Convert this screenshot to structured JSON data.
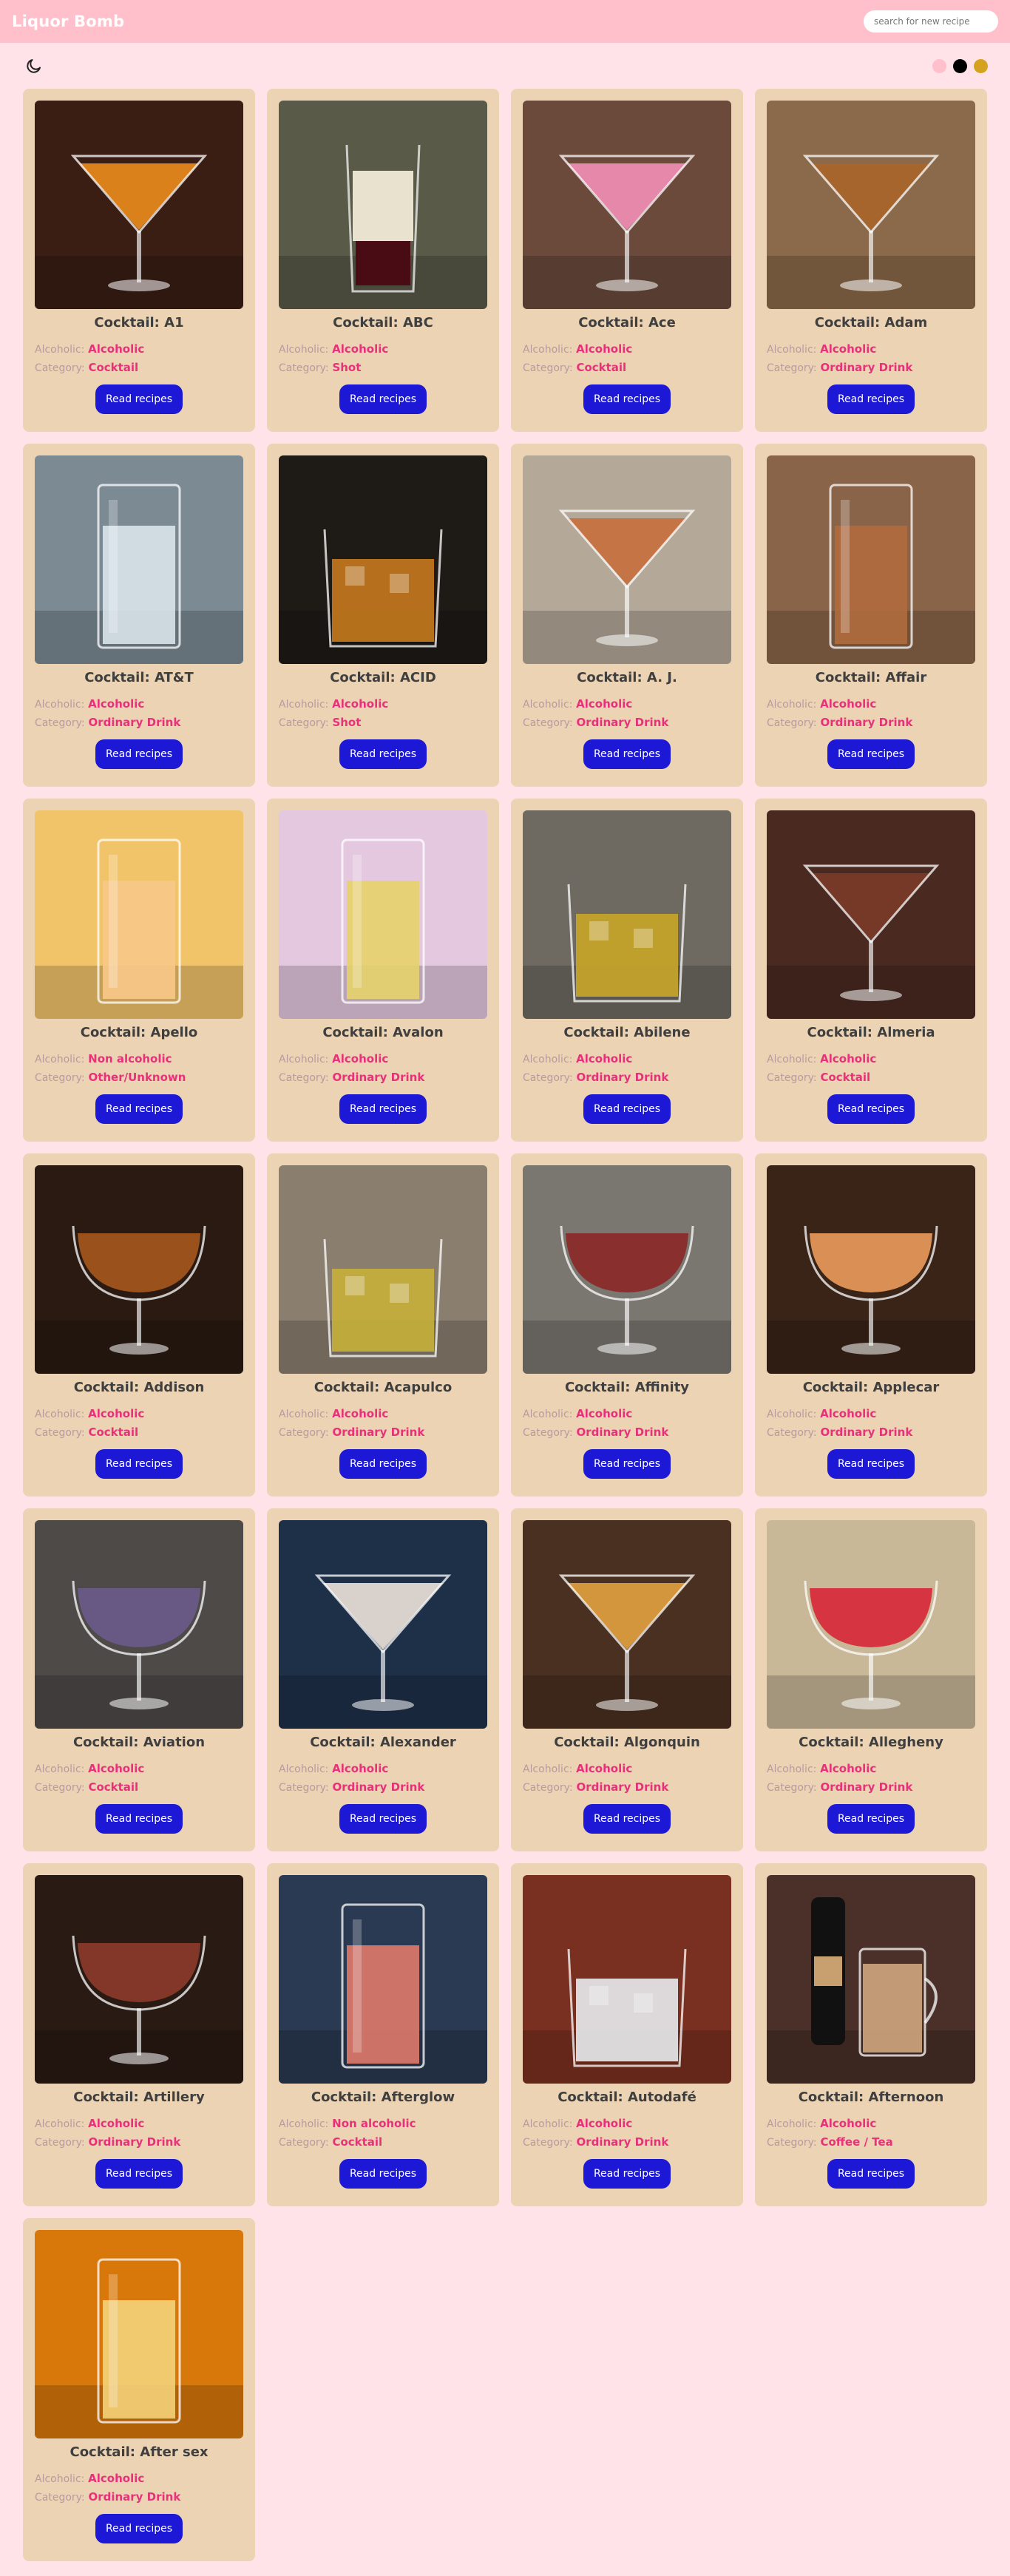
{
  "header": {
    "brand": "Liquor Bomb",
    "search_placeholder": "search for new recipe"
  },
  "toolbar": {
    "theme_icon": "moon-icon",
    "swatches": [
      "#ffbfcb",
      "#000000",
      "#d4a21c"
    ]
  },
  "labels": {
    "alcoholic": "Alcoholic:",
    "category": "Category:",
    "button": "Read recipes"
  },
  "cocktails": [
    {
      "name": "Cocktail: A1",
      "alcoholic": "Alcoholic",
      "category": "Cocktail",
      "bg": "#3a1e14",
      "liquid": "#e88a1c",
      "glass": "martini"
    },
    {
      "name": "Cocktail: ABC",
      "alcoholic": "Alcoholic",
      "category": "Shot",
      "bg": "#5a5a48",
      "liquid": "#e8e2cf",
      "glass": "shot"
    },
    {
      "name": "Cocktail: Ace",
      "alcoholic": "Alcoholic",
      "category": "Cocktail",
      "bg": "#6b4a3c",
      "liquid": "#f08db4",
      "glass": "martini"
    },
    {
      "name": "Cocktail: Adam",
      "alcoholic": "Alcoholic",
      "category": "Ordinary Drink",
      "bg": "#8a6a4a",
      "liquid": "#a8652a",
      "glass": "martini"
    },
    {
      "name": "Cocktail: AT&T",
      "alcoholic": "Alcoholic",
      "category": "Ordinary Drink",
      "bg": "#7c8a94",
      "liquid": "#d9e4ea",
      "glass": "highball"
    },
    {
      "name": "Cocktail: ACID",
      "alcoholic": "Alcoholic",
      "category": "Shot",
      "bg": "#1e1a16",
      "liquid": "#c77a1e",
      "glass": "rocks"
    },
    {
      "name": "Cocktail: A. J.",
      "alcoholic": "Alcoholic",
      "category": "Ordinary Drink",
      "bg": "#b4a898",
      "liquid": "#c7703e",
      "glass": "martini"
    },
    {
      "name": "Cocktail: Affair",
      "alcoholic": "Alcoholic",
      "category": "Ordinary Drink",
      "bg": "#8a6448",
      "liquid": "#b06a3e",
      "glass": "highball"
    },
    {
      "name": "Cocktail: Apello",
      "alcoholic": "Non alcoholic",
      "category": "Other/Unknown",
      "bg": "#f2c46a",
      "liquid": "#f7c88a",
      "glass": "highball"
    },
    {
      "name": "Cocktail: Avalon",
      "alcoholic": "Alcoholic",
      "category": "Ordinary Drink",
      "bg": "#e4c8e0",
      "liquid": "#e6d16a",
      "glass": "highball"
    },
    {
      "name": "Cocktail: Abilene",
      "alcoholic": "Alcoholic",
      "category": "Ordinary Drink",
      "bg": "#6e6a62",
      "liquid": "#c9a628",
      "glass": "rocks"
    },
    {
      "name": "Cocktail: Almeria",
      "alcoholic": "Alcoholic",
      "category": "Cocktail",
      "bg": "#4a2a20",
      "liquid": "#7a3a28",
      "glass": "martini"
    },
    {
      "name": "Cocktail: Addison",
      "alcoholic": "Alcoholic",
      "category": "Cocktail",
      "bg": "#2a1a12",
      "liquid": "#a4561c",
      "glass": "coupe"
    },
    {
      "name": "Cocktail: Acapulco",
      "alcoholic": "Alcoholic",
      "category": "Ordinary Drink",
      "bg": "#8a7e6e",
      "liquid": "#c6b03a",
      "glass": "rocks"
    },
    {
      "name": "Cocktail: Affinity",
      "alcoholic": "Alcoholic",
      "category": "Ordinary Drink",
      "bg": "#7a7670",
      "liquid": "#8a2a28",
      "glass": "coupe"
    },
    {
      "name": "Cocktail: Applecar",
      "alcoholic": "Alcoholic",
      "category": "Ordinary Drink",
      "bg": "#3a2418",
      "liquid": "#e89a5a",
      "glass": "coupe"
    },
    {
      "name": "Cocktail: Aviation",
      "alcoholic": "Alcoholic",
      "category": "Cocktail",
      "bg": "#4e4a48",
      "liquid": "#6a5a8a",
      "glass": "coupe"
    },
    {
      "name": "Cocktail: Alexander",
      "alcoholic": "Alcoholic",
      "category": "Ordinary Drink",
      "bg": "#1e3048",
      "liquid": "#e8e0d8",
      "glass": "martini"
    },
    {
      "name": "Cocktail: Algonquin",
      "alcoholic": "Alcoholic",
      "category": "Ordinary Drink",
      "bg": "#4a3020",
      "liquid": "#e0a040",
      "glass": "martini"
    },
    {
      "name": "Cocktail: Allegheny",
      "alcoholic": "Alcoholic",
      "category": "Ordinary Drink",
      "bg": "#c8b898",
      "liquid": "#d8283a",
      "glass": "coupe"
    },
    {
      "name": "Cocktail: Artillery",
      "alcoholic": "Alcoholic",
      "category": "Ordinary Drink",
      "bg": "#2a1a14",
      "liquid": "#8a3a2a",
      "glass": "coupe"
    },
    {
      "name": "Cocktail: Afterglow",
      "alcoholic": "Non alcoholic",
      "category": "Cocktail",
      "bg": "#2a3a52",
      "liquid": "#e07a6a",
      "glass": "highball"
    },
    {
      "name": "Cocktail: Autodafé",
      "alcoholic": "Alcoholic",
      "category": "Ordinary Drink",
      "bg": "#7a3020",
      "liquid": "#e8ecee",
      "glass": "rocks"
    },
    {
      "name": "Cocktail: Afternoon",
      "alcoholic": "Alcoholic",
      "category": "Coffee / Tea",
      "bg": "#4a3028",
      "liquid": "#c8a07a",
      "glass": "mug"
    },
    {
      "name": "Cocktail: After sex",
      "alcoholic": "Alcoholic",
      "category": "Ordinary Drink",
      "bg": "#d8780a",
      "liquid": "#f4d27a",
      "glass": "highball"
    }
  ]
}
